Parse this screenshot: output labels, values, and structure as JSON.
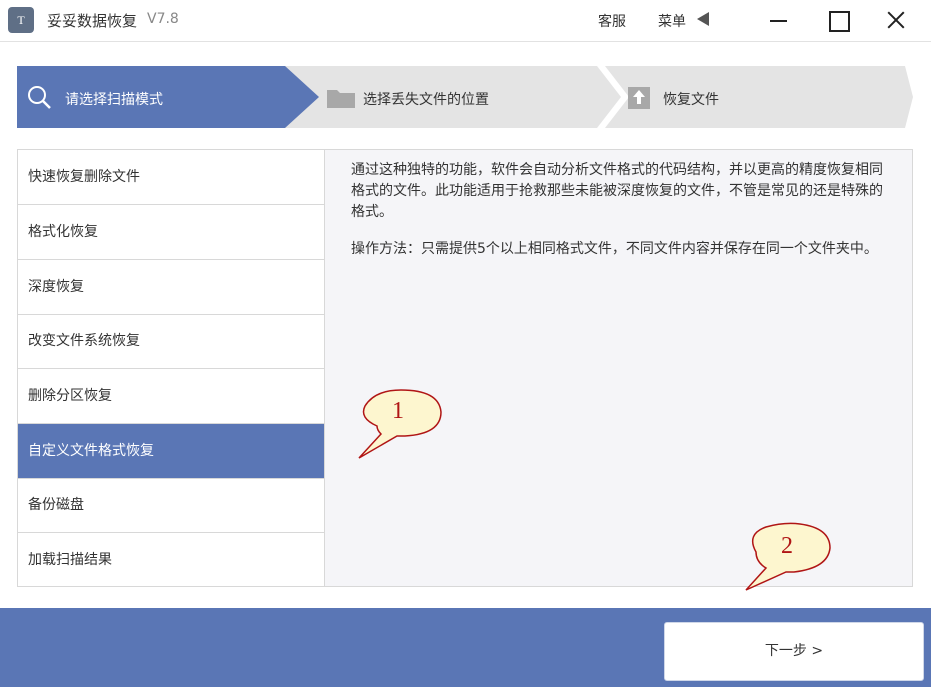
{
  "titlebar": {
    "logo_text": "T",
    "app_name": "妥妥数据恢复",
    "version": "V7.8",
    "service_label": "客服",
    "menu_label": "菜单"
  },
  "steps": [
    {
      "label": "请选择扫描模式",
      "icon": "search-icon",
      "active": true
    },
    {
      "label": "选择丢失文件的位置",
      "icon": "folder-icon",
      "active": false
    },
    {
      "label": "恢复文件",
      "icon": "upload-icon",
      "active": false
    }
  ],
  "modes": [
    {
      "label": "快速恢复删除文件"
    },
    {
      "label": "格式化恢复"
    },
    {
      "label": "深度恢复"
    },
    {
      "label": "改变文件系统恢复"
    },
    {
      "label": "删除分区恢复"
    },
    {
      "label": "自定义文件格式恢复",
      "selected": true
    },
    {
      "label": "备份磁盘"
    },
    {
      "label": "加载扫描结果"
    }
  ],
  "description": {
    "text": "通过这种独特的功能，软件会自动分析文件格式的代码结构，并以更高的精度恢复相同格式的文件。此功能适用于抢救那些未能被深度恢复的文件，不管是常见的还是特殊的格式。",
    "method": "操作方法：只需提供5个以上相同格式文件，不同文件内容并保存在同一个文件夹中。"
  },
  "callouts": [
    "1",
    "2"
  ],
  "footer": {
    "next_label": "下一步 >"
  },
  "colors": {
    "accent": "#5a76b5",
    "step_inactive": "#e4e4e4",
    "callout_fill": "#fdf6cf",
    "callout_text": "#b01515"
  }
}
